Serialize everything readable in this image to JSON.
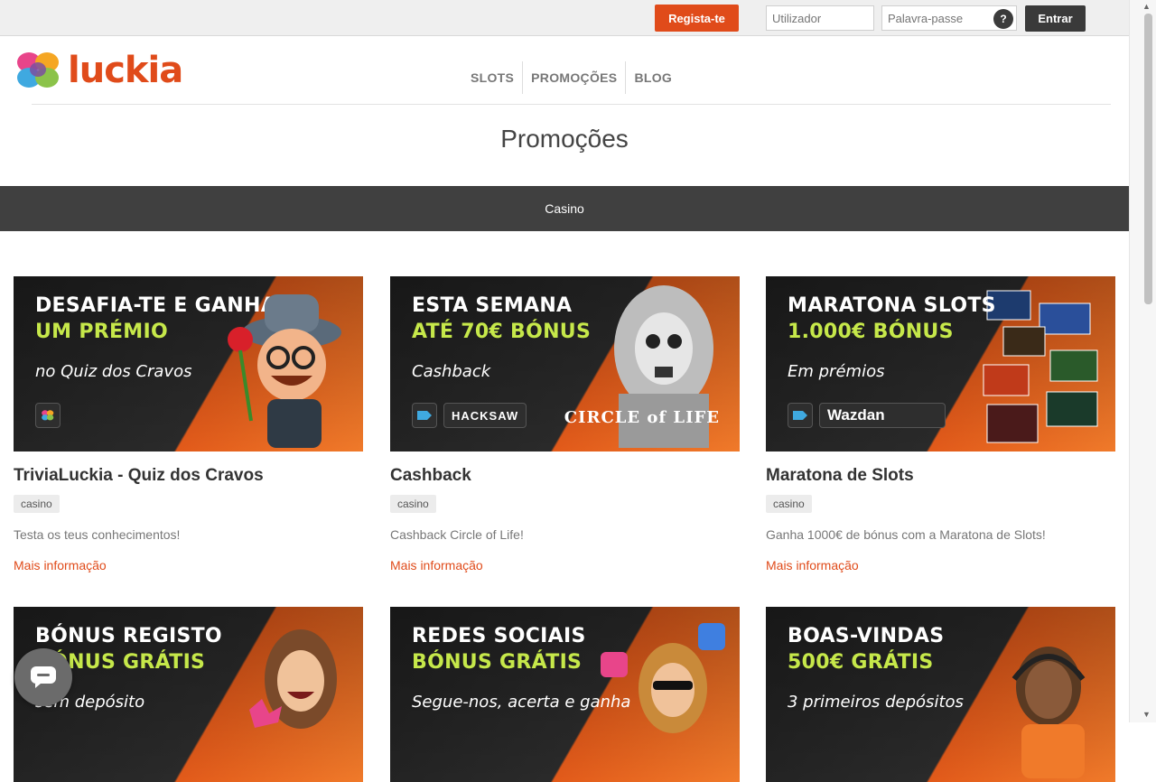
{
  "topbar": {
    "register_label": "Regista-te",
    "username_placeholder": "Utilizador",
    "password_placeholder": "Palavra-passe",
    "help_label": "?",
    "login_label": "Entrar"
  },
  "header": {
    "logo_text": "luckia",
    "nav": [
      "SLOTS",
      "PROMOÇÕES",
      "BLOG"
    ]
  },
  "page_title": "Promoções",
  "category": "Casino",
  "cards": [
    {
      "banner_line1": "DESAFIA-TE E GANHA",
      "banner_line2": "UM PRÉMIO",
      "banner_line3": "no Quiz dos Cravos",
      "title": "TriviaLuckia - Quiz dos Cravos",
      "tag": "casino",
      "description": "Testa os teus conhecimentos!",
      "link": "Mais informação"
    },
    {
      "banner_line1": "ESTA SEMANA",
      "banner_line2": "ATÉ 70€ BÓNUS",
      "banner_line3": "Cashback",
      "banner_provider": "HACKSAW",
      "banner_art": "CIRCLE of LIFE",
      "title": "Cashback",
      "tag": "casino",
      "description": "Cashback Circle of Life!",
      "link": "Mais informação"
    },
    {
      "banner_line1": "MARATONA SLOTS",
      "banner_line2": "1.000€ BÓNUS",
      "banner_line3": "Em prémios",
      "banner_provider": "Wazdan",
      "title": "Maratona de Slots",
      "tag": "casino",
      "description": "Ganha 1000€ de bónus com a Maratona de Slots!",
      "link": "Mais informação"
    },
    {
      "banner_line1": "BÓNUS REGISTO",
      "banner_line2": "BÓNUS GRÁTIS",
      "banner_line3": "sem depósito"
    },
    {
      "banner_line1": "REDES SOCIAIS",
      "banner_line2": "BÓNUS GRÁTIS",
      "banner_line3": "Segue-nos, acerta e ganha"
    },
    {
      "banner_line1": "BOAS-VINDAS",
      "banner_line2": "500€ GRÁTIS",
      "banner_line3": "3 primeiros depósitos"
    }
  ],
  "colors": {
    "brand": "#e04b1a",
    "accent_green": "#c6e84a",
    "dark": "#404040"
  }
}
